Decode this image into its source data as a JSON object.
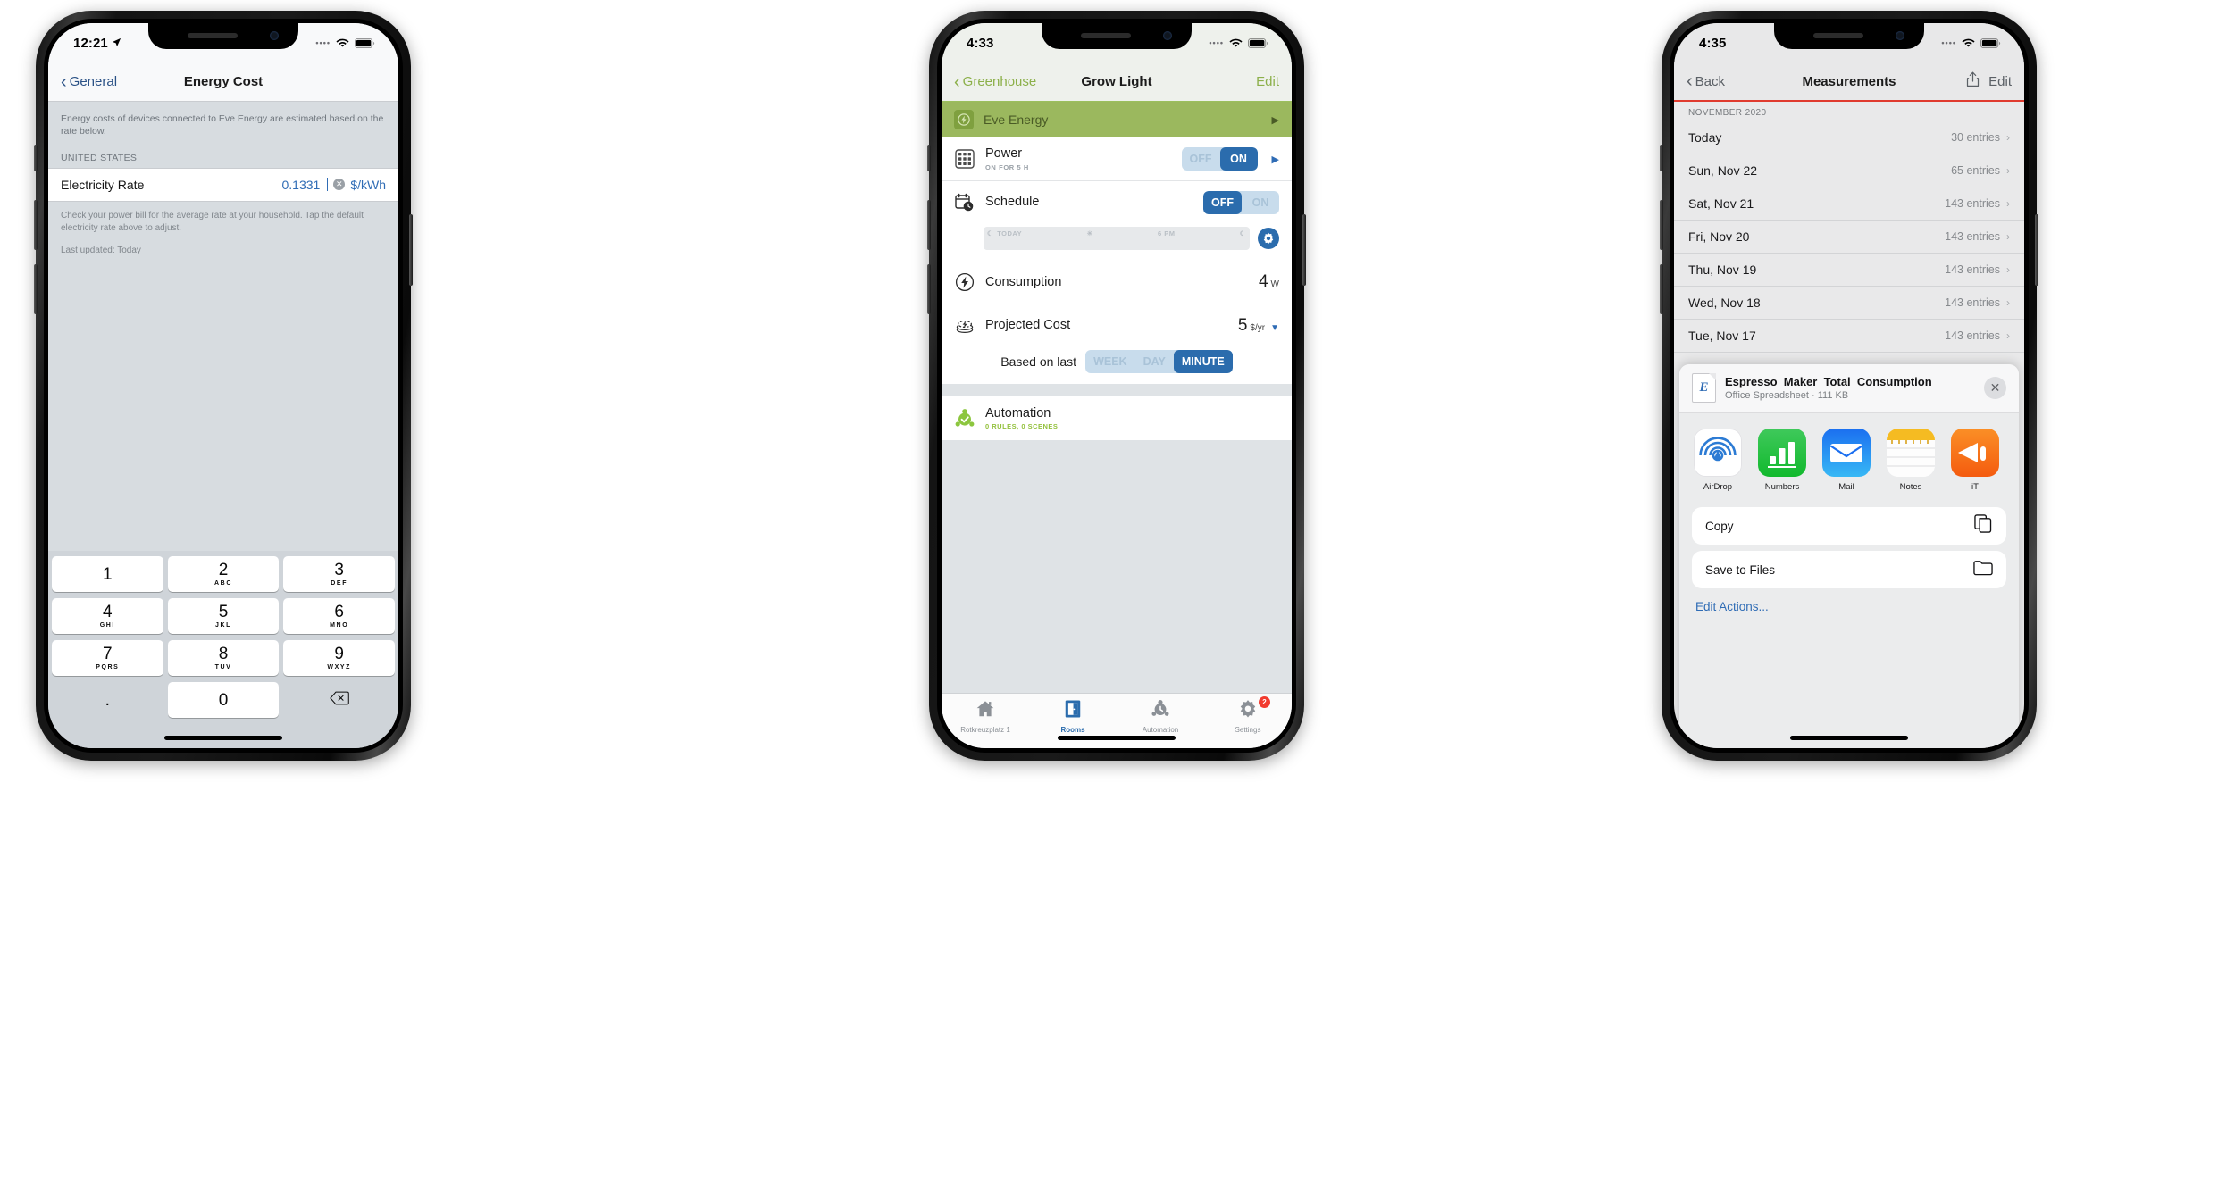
{
  "phone1": {
    "status": {
      "time": "12:21",
      "location_icon": "location-arrow-icon",
      "wifi_icon": "wifi-icon",
      "battery_icon": "battery-icon",
      "signal_dots": "••••"
    },
    "nav": {
      "back_label": "General",
      "title": "Energy Cost"
    },
    "description": "Energy costs of devices connected to Eve Energy are estimated based on the rate below.",
    "section_header": "UNITED STATES",
    "rate_row": {
      "label": "Electricity Rate",
      "value": "0.1331",
      "unit": "$/kWh",
      "clear_icon": "clear-circle-icon"
    },
    "footer": "Check your power bill for the average rate at your household. Tap the default electricity rate above to adjust.",
    "last_updated": "Last updated: Today",
    "keypad": [
      [
        {
          "num": "1",
          "sub": ""
        },
        {
          "num": "2",
          "sub": "ABC"
        },
        {
          "num": "3",
          "sub": "DEF"
        }
      ],
      [
        {
          "num": "4",
          "sub": "GHI"
        },
        {
          "num": "5",
          "sub": "JKL"
        },
        {
          "num": "6",
          "sub": "MNO"
        }
      ],
      [
        {
          "num": "7",
          "sub": "PQRS"
        },
        {
          "num": "8",
          "sub": "TUV"
        },
        {
          "num": "9",
          "sub": "WXYZ"
        }
      ],
      [
        {
          "num": ".",
          "sub": ""
        },
        {
          "num": "0",
          "sub": ""
        },
        {
          "num": "delete-icon",
          "sub": ""
        }
      ]
    ]
  },
  "phone2": {
    "status": {
      "time": "4:33",
      "wifi_icon": "wifi-icon",
      "battery_icon": "battery-icon"
    },
    "nav": {
      "back_label": "Greenhouse",
      "title": "Grow Light",
      "edit_label": "Edit"
    },
    "device": {
      "name": "Eve Energy",
      "icon": "eve-energy-icon",
      "arrow_icon": "chevron-right-icon"
    },
    "power": {
      "title": "Power",
      "subtitle": "ON FOR 5 H",
      "icon": "outlet-grid-icon",
      "off_label": "OFF",
      "on_label": "ON",
      "selected": "ON",
      "arrow_icon": "chevron-right-icon"
    },
    "schedule": {
      "title": "Schedule",
      "icon": "calendar-clock-icon",
      "off_label": "OFF",
      "on_label": "ON",
      "selected": "OFF",
      "timeline": {
        "start_label": "TODAY",
        "mid_label": "6 PM",
        "moon_icon": "moon-icon",
        "sun_icon": "sun-icon"
      },
      "gear_icon": "gear-icon"
    },
    "consumption": {
      "title": "Consumption",
      "icon": "bolt-circle-icon",
      "value": "4",
      "unit": "W"
    },
    "projected_cost": {
      "title": "Projected Cost",
      "icon": "coins-bolt-icon",
      "value": "5",
      "unit": "$/yr",
      "caret_icon": "caret-down-icon"
    },
    "based_on": {
      "label": "Based on last",
      "options": [
        "WEEK",
        "DAY",
        "MINUTE"
      ],
      "selected": "MINUTE"
    },
    "automation": {
      "title": "Automation",
      "subtitle": "0 RULES, 0 SCENES",
      "icon": "automation-check-icon"
    },
    "tabs": [
      {
        "label": "Rotkreuzplatz 1",
        "icon": "home-icon",
        "active": false,
        "badge": ""
      },
      {
        "label": "Rooms",
        "icon": "door-icon",
        "active": true,
        "badge": ""
      },
      {
        "label": "Automation",
        "icon": "automation-icon",
        "active": false,
        "badge": ""
      },
      {
        "label": "Settings",
        "icon": "gear-icon",
        "active": false,
        "badge": "2"
      }
    ]
  },
  "phone3": {
    "status": {
      "time": "4:35",
      "wifi_icon": "wifi-icon",
      "battery_icon": "battery-icon"
    },
    "nav": {
      "back_label": "Back",
      "title": "Measurements",
      "share_icon": "share-icon",
      "edit_label": "Edit"
    },
    "section_header": "NOVEMBER 2020",
    "rows": [
      {
        "date": "Today",
        "entries": "30 entries"
      },
      {
        "date": "Sun, Nov 22",
        "entries": "65 entries"
      },
      {
        "date": "Sat, Nov 21",
        "entries": "143 entries"
      },
      {
        "date": "Fri, Nov 20",
        "entries": "143 entries"
      },
      {
        "date": "Thu, Nov 19",
        "entries": "143 entries"
      },
      {
        "date": "Wed, Nov 18",
        "entries": "143 entries"
      },
      {
        "date": "Tue, Nov 17",
        "entries": "143 entries"
      }
    ],
    "share_sheet": {
      "file_name": "Espresso_Maker_Total_Consumption",
      "file_meta": "Office Spreadsheet · 111 KB",
      "file_icon": "excel-doc-icon",
      "close_icon": "close-icon",
      "apps": [
        {
          "name": "AirDrop",
          "icon": "airdrop-icon"
        },
        {
          "name": "Numbers",
          "icon": "numbers-icon"
        },
        {
          "name": "Mail",
          "icon": "mail-icon"
        },
        {
          "name": "Notes",
          "icon": "notes-icon"
        },
        {
          "name": "iT",
          "icon": "itunes-icon"
        }
      ],
      "actions": [
        {
          "label": "Copy",
          "icon": "copy-icon"
        },
        {
          "label": "Save to Files",
          "icon": "folder-icon"
        }
      ],
      "edit_actions_label": "Edit Actions..."
    }
  }
}
